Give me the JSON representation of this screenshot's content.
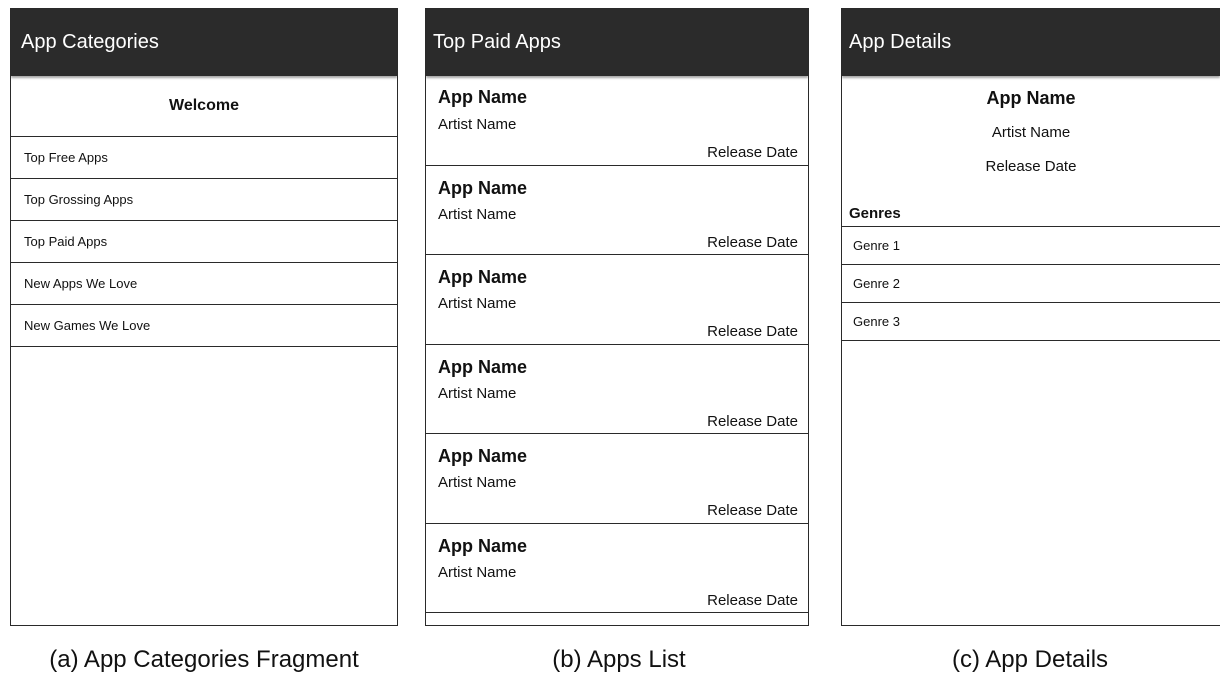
{
  "panels": {
    "categories": {
      "title": "App Categories",
      "welcome": "Welcome",
      "items": [
        "Top Free Apps",
        "Top Grossing Apps",
        "Top Paid Apps",
        "New Apps We Love",
        "New Games We Love"
      ]
    },
    "apps_list": {
      "title": "Top Paid Apps",
      "rows": [
        {
          "name": "App Name",
          "artist": "Artist Name",
          "date": "Release Date"
        },
        {
          "name": "App Name",
          "artist": "Artist Name",
          "date": "Release Date"
        },
        {
          "name": "App Name",
          "artist": "Artist Name",
          "date": "Release Date"
        },
        {
          "name": "App Name",
          "artist": "Artist Name",
          "date": "Release Date"
        },
        {
          "name": "App Name",
          "artist": "Artist Name",
          "date": "Release Date"
        },
        {
          "name": "App Name",
          "artist": "Artist Name",
          "date": "Release Date"
        }
      ]
    },
    "details": {
      "title": "App Details",
      "name": "App Name",
      "artist": "Artist Name",
      "date": "Release Date",
      "genres_heading": "Genres",
      "genres": [
        "Genre 1",
        "Genre 2",
        "Genre 3"
      ]
    }
  },
  "captions": {
    "a": "(a) App Categories Fragment",
    "b": "(b) Apps List",
    "c": "(c) App Details"
  },
  "colors": {
    "titlebar": "#2b2b2b",
    "border": "#2a2a2a"
  }
}
